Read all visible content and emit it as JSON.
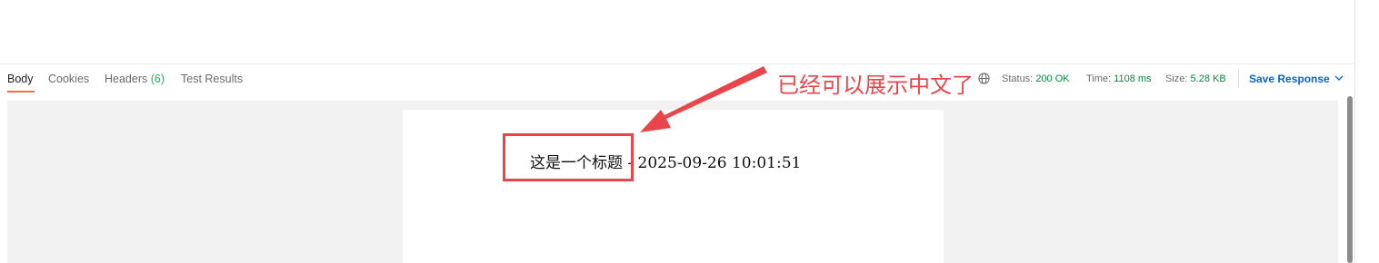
{
  "tabs": [
    {
      "label": "Body"
    },
    {
      "label": "Cookies"
    },
    {
      "label": "Headers",
      "count": "(6)"
    },
    {
      "label": "Test Results"
    }
  ],
  "status": {
    "label": "Status:",
    "value": "200 OK"
  },
  "time": {
    "label": "Time:",
    "value": "1108 ms"
  },
  "size": {
    "label": "Size:",
    "value": "5.28 KB"
  },
  "save_response_label": "Save Response",
  "preview": {
    "title_text": "这是一个标题 - 2025-09-26 10:01:51"
  },
  "annotation": {
    "text": "已经可以展示中文了"
  },
  "colors": {
    "accent": "#ff6c37",
    "annotation": "#e8464a",
    "link": "#0265d2",
    "ok": "#0a8a3c"
  },
  "icons": {
    "globe": "globe-icon",
    "chevron": "chevron-down-icon"
  }
}
